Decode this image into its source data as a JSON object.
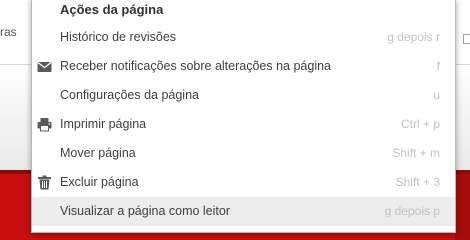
{
  "background": {
    "left_text": "ras",
    "accent_color": "#c80f0f"
  },
  "menu": {
    "title": "Ações da página",
    "items": [
      {
        "label": "Histórico de revisões",
        "shortcut": "g depois r",
        "icon": null
      },
      {
        "label": "Receber notificações sobre alterações na página",
        "shortcut": "f",
        "icon": "envelope-icon"
      },
      {
        "label": "Configurações da página",
        "shortcut": "u",
        "icon": null
      },
      {
        "label": "Imprimir página",
        "shortcut": "Ctrl + p",
        "icon": "printer-icon"
      },
      {
        "label": "Mover página",
        "shortcut": "Shift + m",
        "icon": null
      },
      {
        "label": "Excluir página",
        "shortcut": "Shift + 3",
        "icon": "trash-icon"
      },
      {
        "label": "Visualizar a página como leitor",
        "shortcut": "g depois p",
        "icon": null,
        "highlighted": true
      }
    ]
  }
}
